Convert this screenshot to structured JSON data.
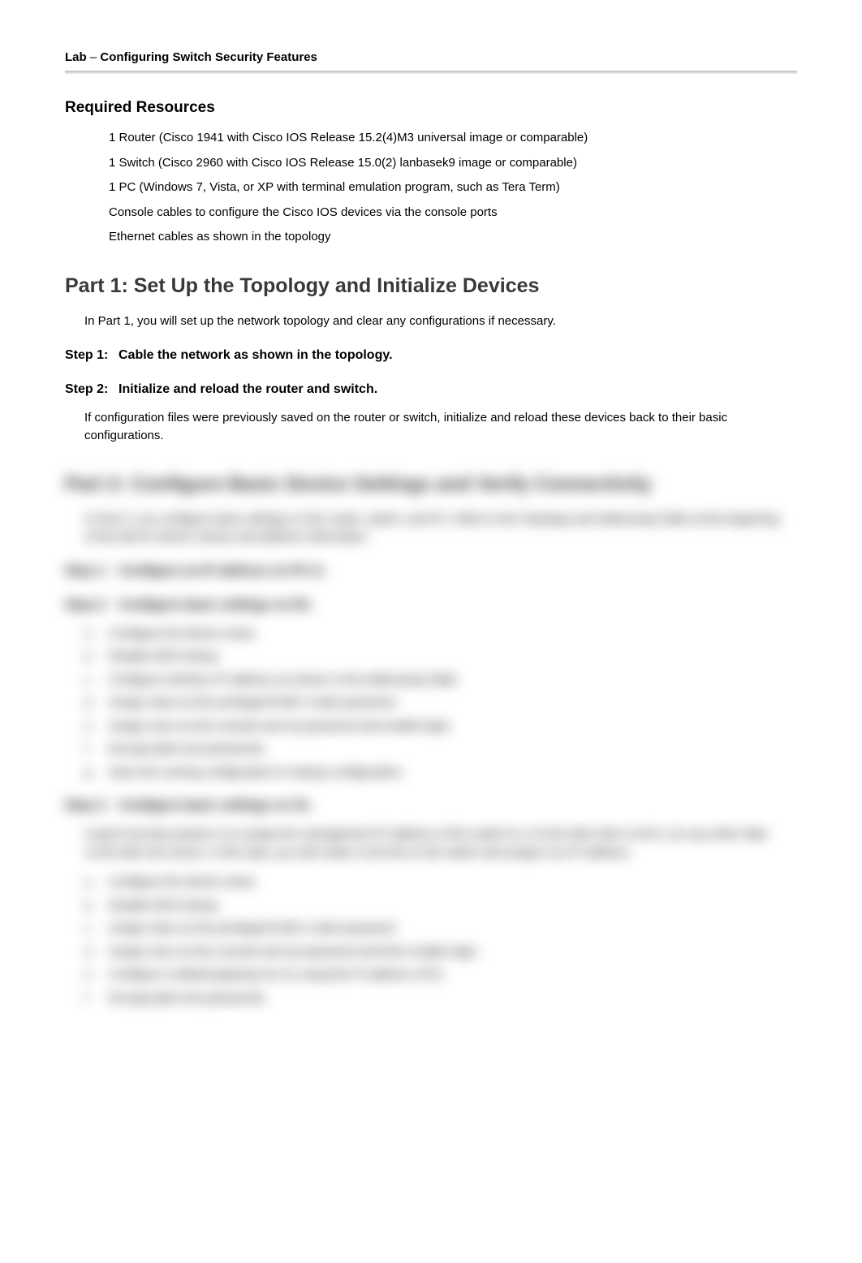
{
  "header": {
    "prefix": "Lab",
    "dash": "–",
    "title": "Configuring Switch Security Features"
  },
  "required_resources": {
    "heading": "Required Resources",
    "items": [
      "1 Router (Cisco 1941 with Cisco IOS Release 15.2(4)M3 universal image or comparable)",
      "1 Switch (Cisco 2960 with Cisco IOS Release 15.0(2) lanbasek9 image or comparable)",
      "1 PC (Windows 7, Vista, or XP with terminal emulation program, such as Tera Term)",
      "Console cables to configure the Cisco IOS devices via the console ports",
      "Ethernet cables as shown in the topology"
    ]
  },
  "part1": {
    "heading": "Part 1: Set Up the Topology and Initialize Devices",
    "intro": "In Part 1, you will set up the network topology and clear any configurations if necessary.",
    "step1": {
      "num": "Step 1:",
      "title": "Cable the network as shown in the topology."
    },
    "step2": {
      "num": "Step 2:",
      "title": "Initialize and reload the router and switch.",
      "body": "If configuration files were previously saved on the router or switch, initialize and reload these devices back to their basic configurations."
    }
  },
  "part2_blurred": {
    "heading": "Part 2: Configure Basic Device Settings and Verify Connectivity",
    "intro": "In Part 2, you configure basic settings on the router, switch, and PC. Refer to the Topology and Addressing Table at the beginning of this lab for device names and address information.",
    "step1": {
      "num": "Step 1:",
      "title": "Configure an IP address on PC-A."
    },
    "step2": {
      "num": "Step 2:",
      "title": "Configure basic settings on R1."
    },
    "r1_items": [
      "Configure the device name.",
      "Disable DNS lookup.",
      "Configure interface IP address as shown in the Addressing Table.",
      "Assign class as the privileged EXEC mode password.",
      "Assign cisco as the console and vty password and enable login.",
      "Encrypt plain text passwords.",
      "Save the running configuration to startup configuration."
    ],
    "step3": {
      "num": "Step 3:",
      "title": "Configure basic settings on S1."
    },
    "s1_intro": "A good security practice is to assign the management IP address of the switch to a VLAN other than VLAN 1 (or any other data VLAN with end users). In this step, you will create VLAN 99 on the switch and assign it an IP address.",
    "s1_items": [
      "Configure the device name.",
      "Disable DNS lookup.",
      "Assign class as the privileged EXEC mode password.",
      "Assign cisco as the console and vty password and then enable login.",
      "Configure a default gateway for S1 using the IP address of R1.",
      "Encrypt plain text passwords."
    ],
    "letters7": [
      "a.",
      "b.",
      "c.",
      "d.",
      "e.",
      "f.",
      "g."
    ],
    "letters6": [
      "a.",
      "b.",
      "c.",
      "d.",
      "e.",
      "f."
    ]
  },
  "bullet": ""
}
